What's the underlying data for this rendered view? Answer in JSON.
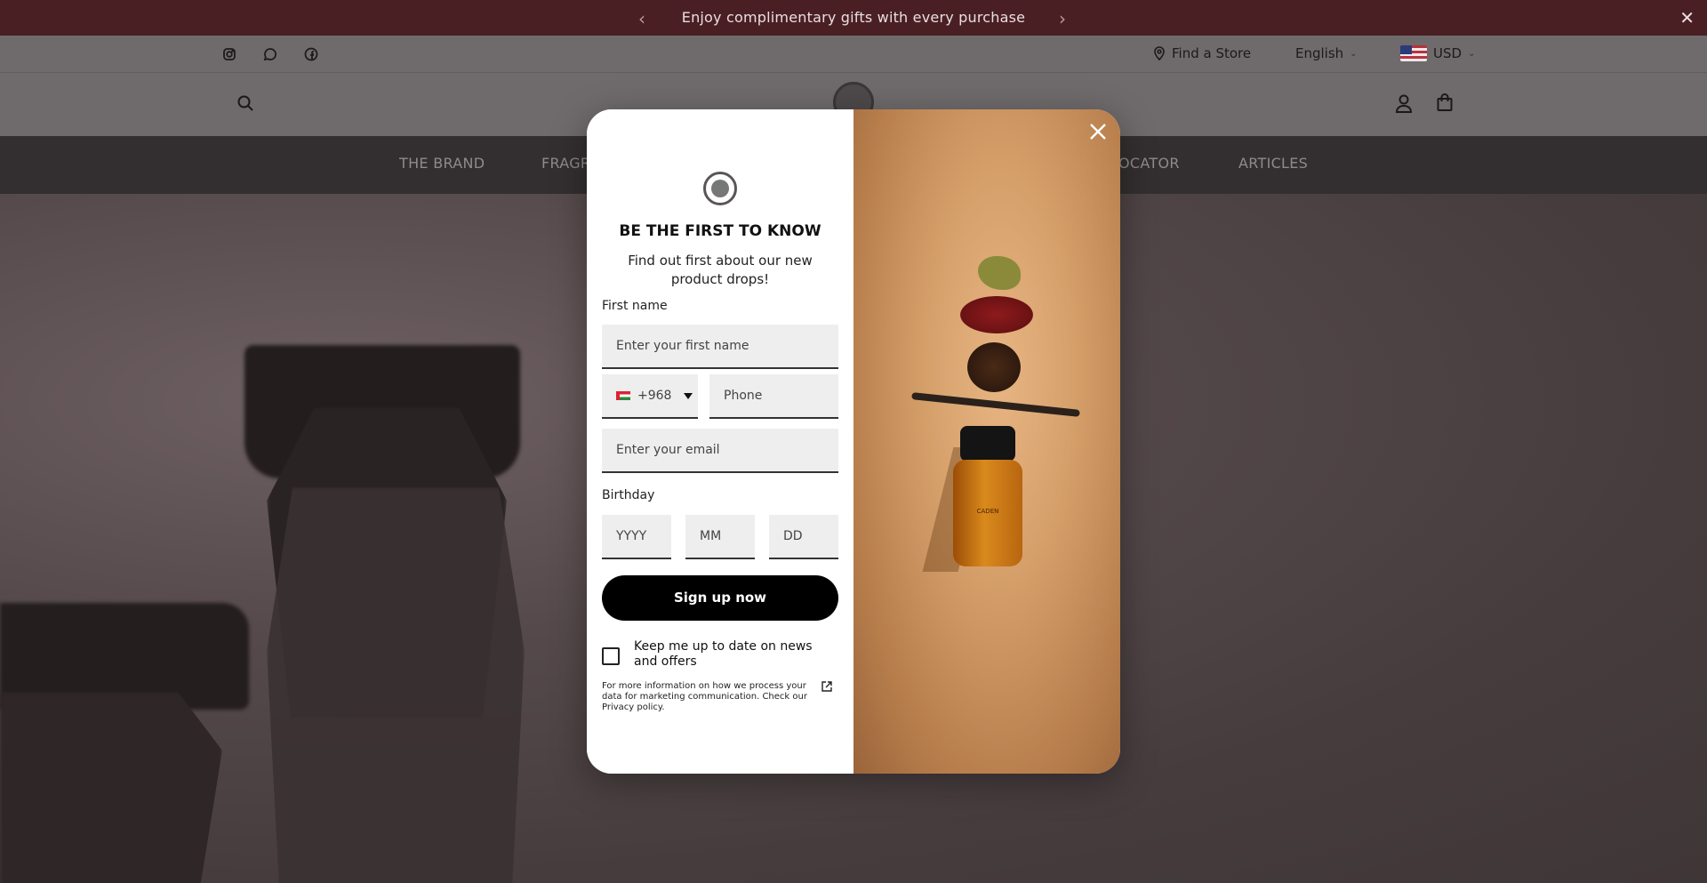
{
  "announcement": {
    "message": "Enjoy complimentary gifts with every purchase",
    "prev_icon": "chevron-left-icon",
    "next_icon": "chevron-right-icon",
    "close_icon": "close-icon"
  },
  "topbar": {
    "social": [
      "instagram-icon",
      "whatsapp-icon",
      "facebook-icon"
    ],
    "find_store": "Find a Store",
    "language": "English",
    "currency": "USD"
  },
  "nav": {
    "items": [
      "THE BRAND",
      "FRAGR",
      "OCATOR",
      "ARTICLES"
    ]
  },
  "modal": {
    "title": "BE THE FIRST TO KNOW",
    "subtitle": "Find out first about our new product drops!",
    "first_name_label": "First name",
    "first_name_placeholder": "Enter your first name",
    "country_code": "+968",
    "phone_placeholder": "Phone",
    "email_placeholder": "Enter your email",
    "birthday_label": "Birthday",
    "year_placeholder": "YYYY",
    "month_placeholder": "MM",
    "day_placeholder": "DD",
    "submit_label": "Sign up now",
    "consent_label": "Keep me up to date on news and offers",
    "privacy_text": "For more information on how we process your data for marketing communication. Check our Privacy policy.",
    "bottle_label": "CADEN"
  },
  "colors": {
    "announcement_bg": "#4a1f24",
    "nav_bg": "#332f30",
    "button_bg": "#000000"
  }
}
